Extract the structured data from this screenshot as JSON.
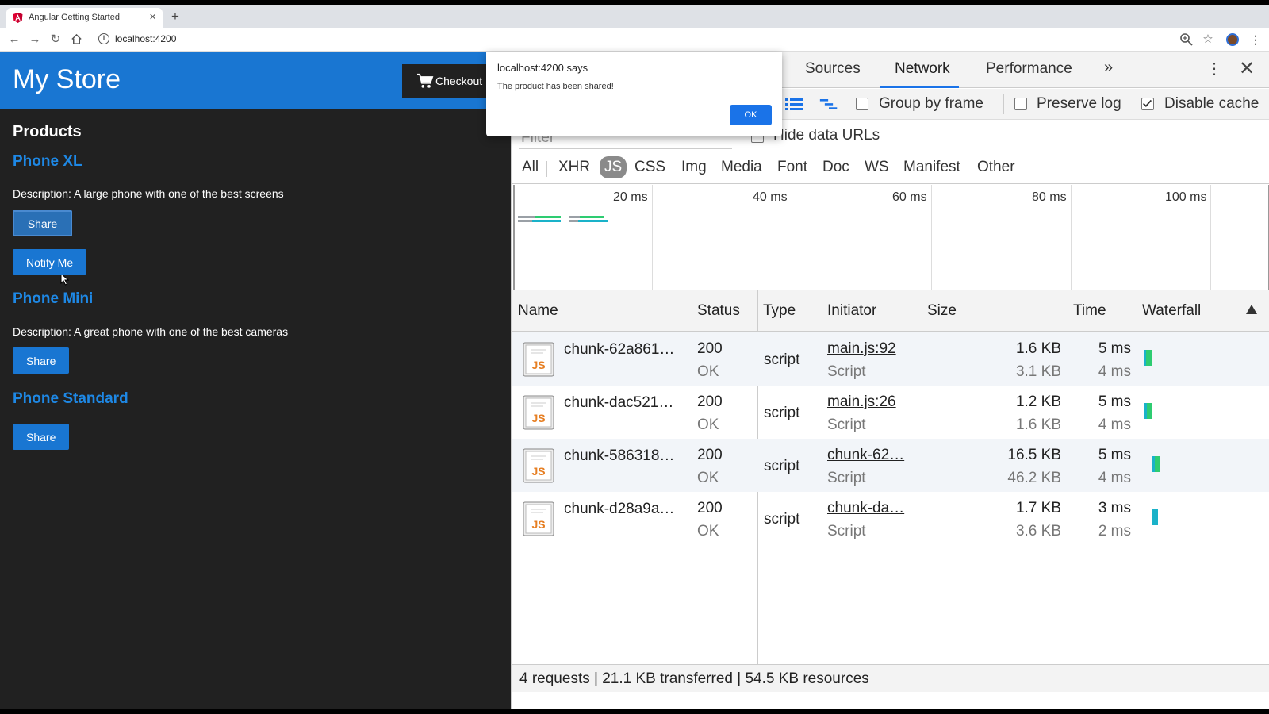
{
  "browser": {
    "tab_title": "Angular Getting Started",
    "url": "localhost:4200"
  },
  "app": {
    "store_title": "My Store",
    "checkout_label": "Checkout",
    "products_heading": "Products",
    "products": [
      {
        "name": "Phone XL",
        "description": "Description: A large phone with one of the best screens",
        "share_label": "Share",
        "notify_label": "Notify Me"
      },
      {
        "name": "Phone Mini",
        "description": "Description: A great phone with one of the best cameras",
        "share_label": "Share"
      },
      {
        "name": "Phone Standard",
        "share_label": "Share"
      }
    ]
  },
  "alert": {
    "title": "localhost:4200 says",
    "message": "The product has been shared!",
    "ok_label": "OK"
  },
  "devtools": {
    "tabs": [
      "Sources",
      "Network",
      "Performance"
    ],
    "active_tab": "Network",
    "more_label": "»",
    "options": {
      "group_by_frame": {
        "label": "Group by frame",
        "checked": false
      },
      "preserve_log": {
        "label": "Preserve log",
        "checked": false
      },
      "disable_cache": {
        "label": "Disable cache",
        "checked": true
      }
    },
    "filter_placeholder": "Filter",
    "hide_data_urls": {
      "label": "Hide data URLs",
      "checked": false
    },
    "type_filters": [
      "All",
      "XHR",
      "JS",
      "CSS",
      "Img",
      "Media",
      "Font",
      "Doc",
      "WS",
      "Manifest",
      "Other"
    ],
    "active_type": "JS",
    "overview_ticks": [
      "20 ms",
      "40 ms",
      "60 ms",
      "80 ms",
      "100 ms"
    ],
    "columns": [
      "Name",
      "Status",
      "Type",
      "Initiator",
      "Size",
      "Time",
      "Waterfall"
    ],
    "rows": [
      {
        "name": "chunk-62a861…",
        "status": "200",
        "status_text": "OK",
        "type": "script",
        "initiator": "main.js:92",
        "initiator_type": "Script",
        "size": "1.6 KB",
        "resource_size": "3.1 KB",
        "time": "5 ms",
        "latency": "4 ms"
      },
      {
        "name": "chunk-dac521…",
        "status": "200",
        "status_text": "OK",
        "type": "script",
        "initiator": "main.js:26",
        "initiator_type": "Script",
        "size": "1.2 KB",
        "resource_size": "1.6 KB",
        "time": "5 ms",
        "latency": "4 ms"
      },
      {
        "name": "chunk-586318…",
        "status": "200",
        "status_text": "OK",
        "type": "script",
        "initiator": "chunk-62…",
        "initiator_type": "Script",
        "size": "16.5 KB",
        "resource_size": "46.2 KB",
        "time": "5 ms",
        "latency": "4 ms"
      },
      {
        "name": "chunk-d28a9a…",
        "status": "200",
        "status_text": "OK",
        "type": "script",
        "initiator": "chunk-da…",
        "initiator_type": "Script",
        "size": "1.7 KB",
        "resource_size": "3.6 KB",
        "time": "3 ms",
        "latency": "2 ms"
      }
    ],
    "summary": "4 requests | 21.1 KB transferred | 54.5 KB resources"
  },
  "colors": {
    "angular_blue": "#1976d2",
    "link_blue": "#1e88e5",
    "app_bg": "#212121",
    "devtools_accent": "#1a73e8",
    "waterfall_green": "#2ecc71",
    "waterfall_teal": "#1ab2c9"
  }
}
